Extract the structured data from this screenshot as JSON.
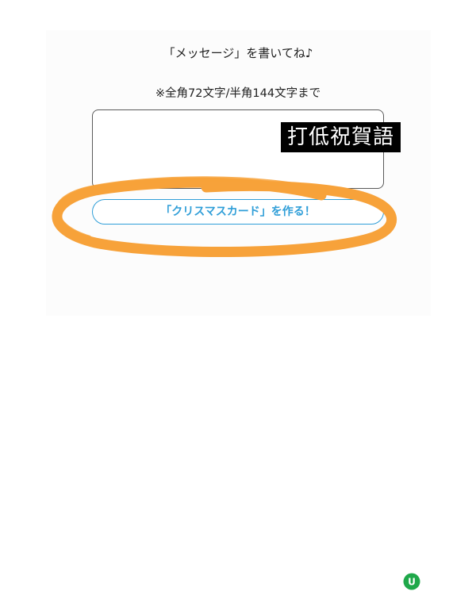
{
  "form": {
    "heading": "「メッセージ」を書いてね♪",
    "limit_note": "※全角72文字/半角144文字まで",
    "message_value": "",
    "message_placeholder": "",
    "create_button_label": "「クリスマスカード」を作る！"
  },
  "overlay": {
    "caption": "打低祝賀語",
    "highlight_color": "#f7a23a"
  },
  "watermark": {
    "logo_letter": "U",
    "icon": "brand-logo-icon",
    "color": "#1fa84a"
  },
  "colors": {
    "accent": "#2f9ed8",
    "text": "#222222"
  }
}
